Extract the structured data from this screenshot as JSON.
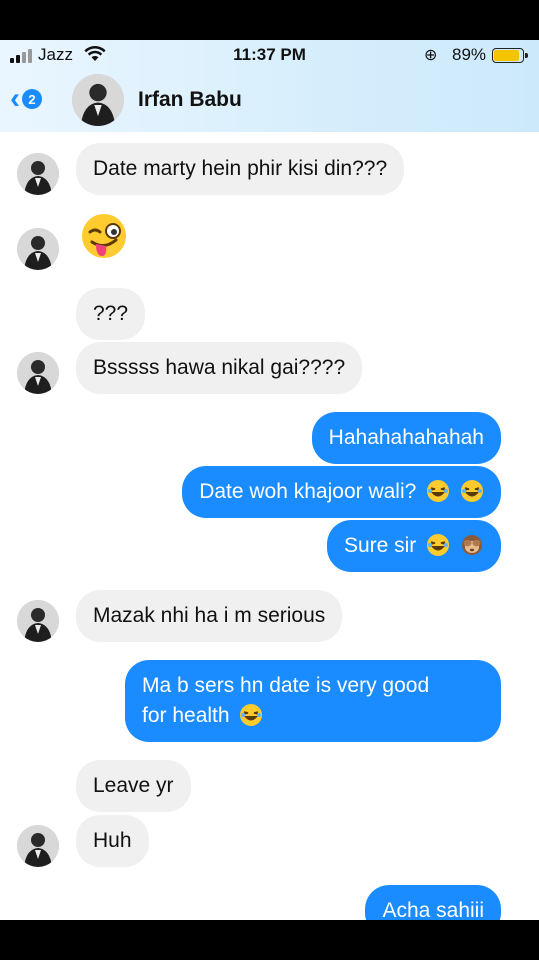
{
  "status_bar": {
    "carrier": "Jazz",
    "time": "11:37 PM",
    "battery": "89%",
    "battery_level": 0.89
  },
  "header": {
    "back_badge": "2",
    "contact_name": "Irfan Babu"
  },
  "messages": [
    {
      "side": "in",
      "text": "Date marty hein phir kisi din???",
      "avatar": true
    },
    {
      "side": "in",
      "emoji": "winking-face-tongue-emoji",
      "avatar": true
    },
    {
      "side": "in",
      "text": "???",
      "avatar": false
    },
    {
      "side": "in",
      "text": "Bsssss hawa nikal gai????",
      "avatar": true
    },
    {
      "side": "out",
      "text": "Hahahahahahah"
    },
    {
      "side": "out",
      "text": "Date woh khajoor wali?",
      "emojis": [
        "laughing-emoji",
        "laughing-emoji"
      ]
    },
    {
      "side": "out",
      "text": "Sure sir",
      "emojis": [
        "laughing-emoji",
        "see-no-evil-monkey-emoji"
      ]
    },
    {
      "side": "in",
      "text": "Mazak nhi ha i m serious",
      "avatar": true
    },
    {
      "side": "out",
      "text_line1": "Ma b sers hn date is very good",
      "text_line2": "for health",
      "emojis": [
        "laughing-emoji"
      ]
    },
    {
      "side": "in",
      "text": "Leave yr",
      "avatar": false
    },
    {
      "side": "in",
      "text": "Huh",
      "avatar": true
    },
    {
      "side": "out",
      "text": "Acha sahiii"
    }
  ]
}
